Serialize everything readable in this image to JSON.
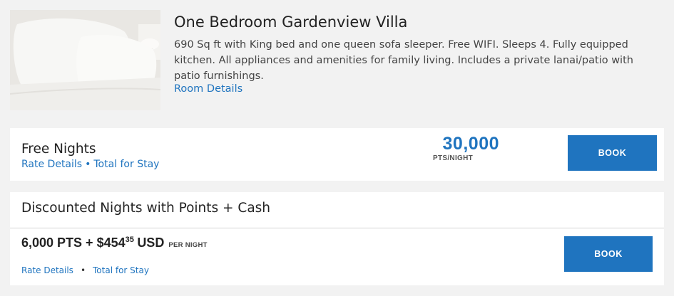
{
  "room": {
    "title": "One Bedroom Gardenview Villa",
    "description": "690 Sq ft with King bed and one queen sofa sleeper. Free WIFI. Sleeps 4. Fully equipped kitchen. All appliances and amenities for family living. Includes a private lanai/patio with patio furnishings.",
    "details_link": "Room Details",
    "image_icon": "pillows-photo"
  },
  "free_nights": {
    "heading": "Free Nights",
    "rate_details": "Rate Details",
    "separator": "•",
    "total_for_stay": "Total for Stay",
    "points": "30,000",
    "points_unit": "PTS/NIGHT",
    "book_label": "BOOK"
  },
  "discounted": {
    "heading": "Discounted Nights with Points + Cash",
    "points": "6,000 PTS + $454",
    "cents": "35",
    "currency": "USD",
    "per_night": "PER NIGHT",
    "rate_details": "Rate Details",
    "separator": "•",
    "total_for_stay": "Total for Stay",
    "book_label": "BOOK"
  },
  "colors": {
    "accent": "#1f74bf",
    "background": "#f2f2f2",
    "card": "#ffffff"
  }
}
